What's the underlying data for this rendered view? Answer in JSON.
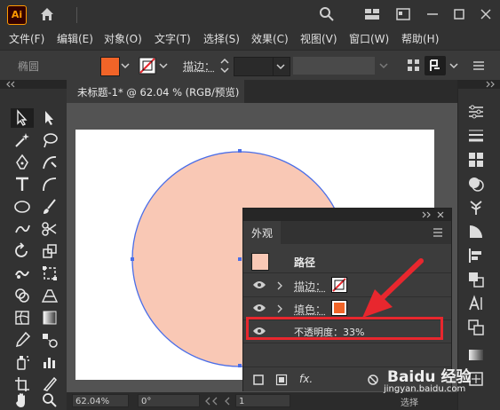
{
  "app": {
    "logo_text": "Ai"
  },
  "menu": [
    "文件(F)",
    "编辑(E)",
    "对象(O)",
    "文字(T)",
    "选择(S)",
    "效果(C)",
    "视图(V)",
    "窗口(W)",
    "帮助(H)"
  ],
  "control": {
    "shape_label": "椭圆",
    "fill_color": "#f16428",
    "stroke_label": "描边："
  },
  "document": {
    "tab_title": "未标题-1* @ 62.04 % (RGB/预览)"
  },
  "artwork": {
    "circle_fill": "#f9c8b5",
    "circle_stroke": "#4a6ee8"
  },
  "appearance_panel": {
    "tab_label": "外观",
    "item_label": "路径",
    "rows": [
      {
        "label": "描边："
      },
      {
        "label": "填色："
      },
      {
        "label": "不透明度：33%"
      }
    ],
    "swatch_color": "#f9c8b5",
    "fill_swatch": "#f16428",
    "fx_label": "fx."
  },
  "status": {
    "zoom": "62.04%",
    "rotation": "0°",
    "artboard": "1",
    "select_label": "选择"
  },
  "watermark": {
    "brand": "Baidu 经验",
    "url": "jingyan.baidu.com"
  }
}
